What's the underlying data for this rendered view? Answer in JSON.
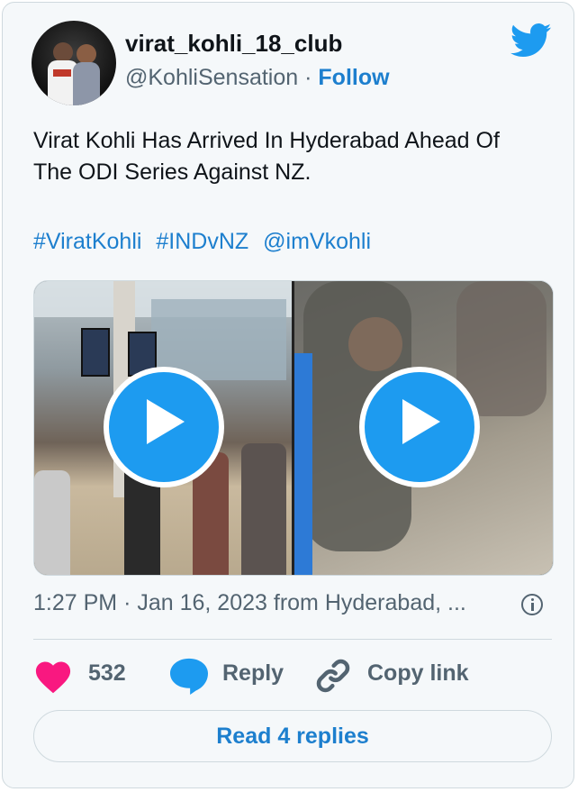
{
  "user": {
    "name": "virat_kohli_18_club",
    "handle": "@KohliSensation",
    "separator": "·",
    "follow_label": "Follow"
  },
  "tweet": {
    "text_line1": "Virat Kohli Has Arrived In Hyderabad Ahead Of",
    "text_line2": "The ODI Series Against NZ.",
    "hashtags": [
      "#ViratKohli",
      "#INDvNZ",
      "@imVkohli"
    ]
  },
  "meta": {
    "time": "1:27 PM",
    "separator": "·",
    "date": "Jan 16, 2023",
    "location": "from Hyderabad, ..."
  },
  "actions": {
    "like_count": "532",
    "reply_label": "Reply",
    "copy_label": "Copy link"
  },
  "read_replies_label": "Read 4 replies",
  "colors": {
    "brand_blue": "#1d9bf0",
    "link_blue": "#1d7fce",
    "like_pink": "#f91880",
    "muted_text": "#536471",
    "card_background": "#f5f8fa"
  },
  "icons": {
    "logo": "twitter-bird-icon",
    "play": "play-icon",
    "info": "info-icon",
    "like": "heart-icon",
    "reply": "speech-bubble-icon",
    "copy": "link-icon"
  }
}
